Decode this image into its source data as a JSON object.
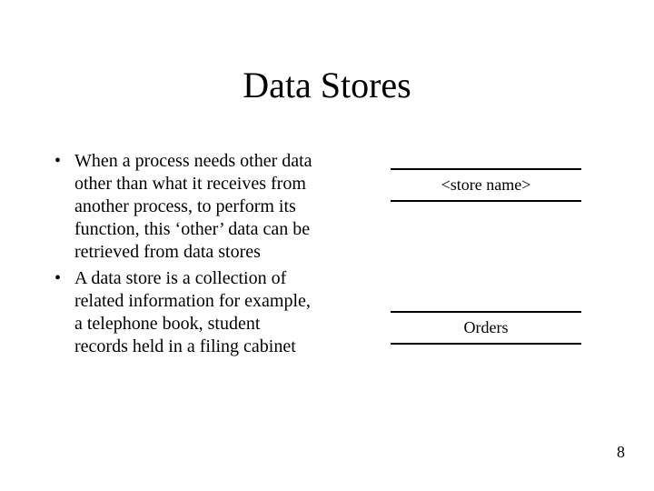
{
  "title": "Data Stores",
  "bullets": [
    "When a process needs other data other than what it receives from another process, to perform its function, this ‘other’ data can be retrieved from data stores",
    "A data store is a collection of related information for example, a telephone book, student records held in a filing cabinet"
  ],
  "diagram": {
    "generic_label": "<store name>",
    "example_label": "Orders"
  },
  "page_number": "8"
}
